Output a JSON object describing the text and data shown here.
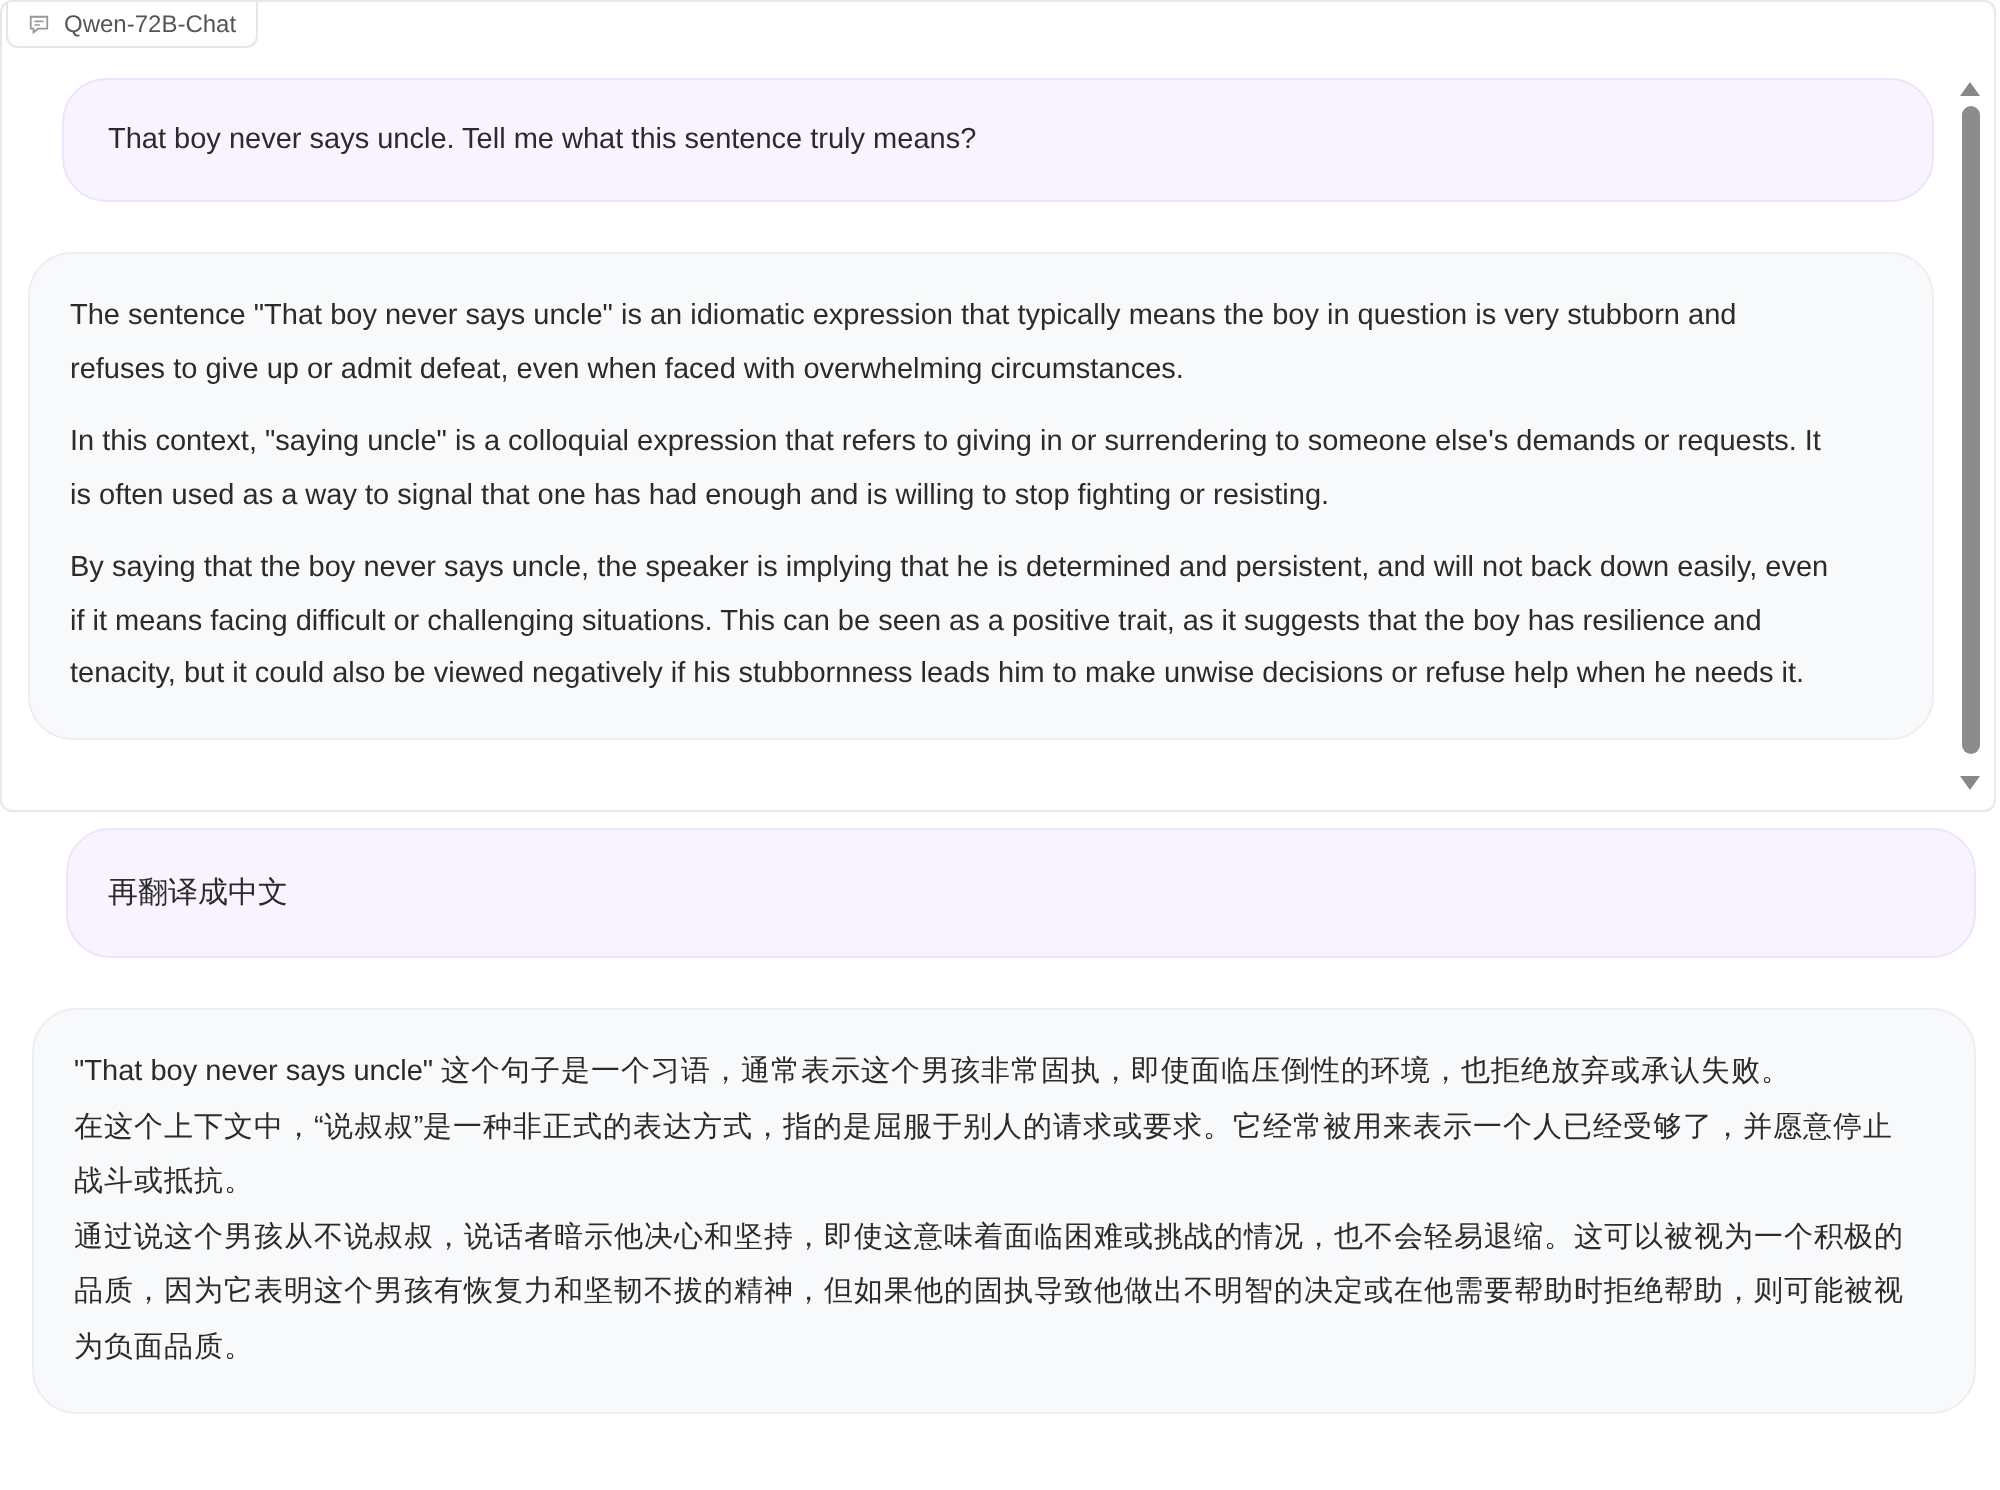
{
  "chatbot_label": "Qwen-72B-Chat",
  "panels": [
    {
      "scrollbar": true,
      "messages": [
        {
          "kind": "user",
          "paragraphs": [
            "That boy never says uncle. Tell me what this sentence truly means?"
          ]
        },
        {
          "kind": "bot",
          "paragraphs": [
            "The sentence \"That boy never says uncle\" is an idiomatic expression that typically means the boy in question is very stubborn and refuses to give up or admit defeat, even when faced with overwhelming circumstances.",
            "In this context, \"saying uncle\" is a colloquial expression that refers to giving in or surrendering to someone else's demands or requests. It is often used as a way to signal that one has had enough and is willing to stop fighting or resisting.",
            "By saying that the boy never says uncle, the speaker is implying that he is determined and persistent, and will not back down easily, even if it means facing difficult or challenging situations. This can be seen as a positive trait, as it suggests that the boy has resilience and tenacity, but it could also be viewed negatively if his stubbornness leads him to make unwise decisions or refuse help when he needs it."
          ]
        }
      ]
    },
    {
      "messages": [
        {
          "kind": "user",
          "paragraphs": [
            "再翻译成中文"
          ]
        },
        {
          "kind": "bot",
          "paragraphs": [
            "\"That boy never says uncle\" 这个句子是一个习语，通常表示这个男孩非常固执，即使面临压倒性的环境，也拒绝放弃或承认失败。",
            "在这个上下文中，“说叔叔”是一种非正式的表达方式，指的是屈服于别人的请求或要求。它经常被用来表示一个人已经受够了，并愿意停止战斗或抵抗。",
            "通过说这个男孩从不说叔叔，说话者暗示他决心和坚持，即使这意味着面临困难或挑战的情况，也不会轻易退缩。这可以被视为一个积极的品质，因为它表明这个男孩有恢复力和坚韧不拔的精神，但如果他的固执导致他做出不明智的决定或在他需要帮助时拒绝帮助，则可能被视为负面品质。"
          ]
        }
      ]
    }
  ]
}
